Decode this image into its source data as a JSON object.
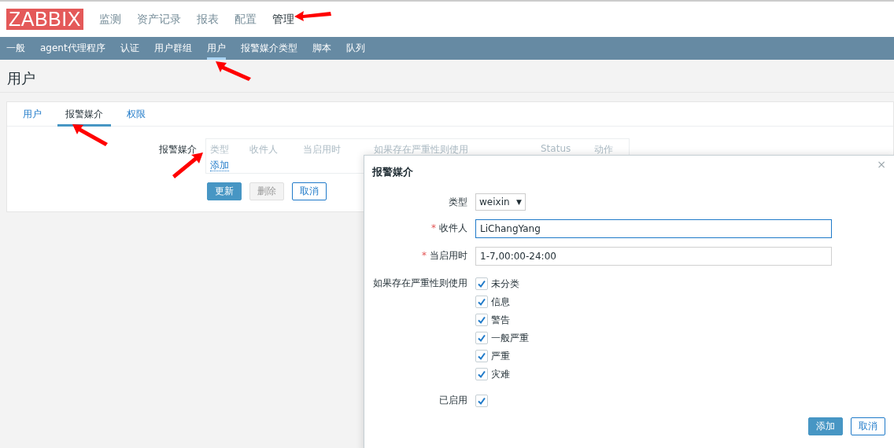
{
  "header": {
    "logo": "ZABBIX",
    "nav": [
      {
        "label": "监测",
        "selected": false
      },
      {
        "label": "资产记录",
        "selected": false
      },
      {
        "label": "报表",
        "selected": false
      },
      {
        "label": "配置",
        "selected": false
      },
      {
        "label": "管理",
        "selected": true
      }
    ]
  },
  "subnav": [
    {
      "label": "一般",
      "selected": false
    },
    {
      "label": "agent代理程序",
      "selected": false
    },
    {
      "label": "认证",
      "selected": false
    },
    {
      "label": "用户群组",
      "selected": false
    },
    {
      "label": "用户",
      "selected": true
    },
    {
      "label": "报警媒介类型",
      "selected": false
    },
    {
      "label": "脚本",
      "selected": false
    },
    {
      "label": "队列",
      "selected": false
    }
  ],
  "page_title": "用户",
  "tabs": [
    {
      "label": "用户",
      "selected": false
    },
    {
      "label": "报警媒介",
      "selected": true
    },
    {
      "label": "权限",
      "selected": false
    }
  ],
  "media": {
    "label": "报警媒介",
    "columns": [
      "类型",
      "收件人",
      "当启用时",
      "如果存在严重性则使用",
      "Status",
      "动作"
    ],
    "add_link": "添加"
  },
  "buttons": [
    {
      "label": "更新",
      "kind": "primary",
      "disabled": false
    },
    {
      "label": "删除",
      "kind": "secondary",
      "disabled": true
    },
    {
      "label": "取消",
      "kind": "secondary",
      "disabled": false
    }
  ],
  "dialog": {
    "title": "报警媒介",
    "close": "×",
    "type": {
      "label": "类型",
      "value": "weixin",
      "caret": "▼"
    },
    "recipient": {
      "required_mark": "*",
      "label": "收件人",
      "value": "LiChangYang"
    },
    "period": {
      "required_mark": "*",
      "label": "当启用时",
      "value": "1-7,00:00-24:00"
    },
    "severity": {
      "label": "如果存在严重性则使用",
      "options": [
        {
          "label": "未分类",
          "checked": true
        },
        {
          "label": "信息",
          "checked": true
        },
        {
          "label": "警告",
          "checked": true
        },
        {
          "label": "一般严重",
          "checked": true
        },
        {
          "label": "严重",
          "checked": true
        },
        {
          "label": "灾难",
          "checked": true
        }
      ]
    },
    "enabled": {
      "label": "已启用",
      "checked": true
    },
    "buttons": [
      {
        "label": "添加",
        "kind": "primary"
      },
      {
        "label": "取消",
        "kind": "secondary"
      }
    ]
  }
}
